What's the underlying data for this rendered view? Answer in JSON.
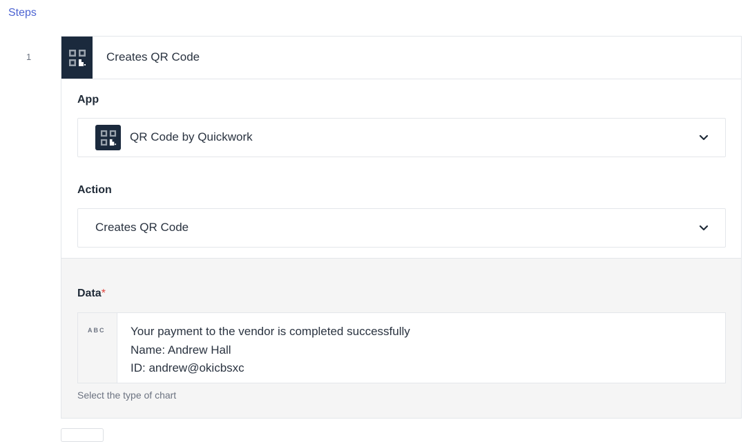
{
  "steps_title": "Steps",
  "step": {
    "number": "1",
    "header_title": "Creates QR Code",
    "app": {
      "label": "App",
      "value": "QR Code by Quickwork",
      "icon": "qr-code-icon"
    },
    "action": {
      "label": "Action",
      "value": "Creates QR Code"
    },
    "data_field": {
      "label": "Data",
      "required_mark": "*",
      "type_badge": "ABC",
      "lines": [
        "Your payment to the vendor is completed successfully",
        "Name: Andrew Hall",
        "ID: andrew@okicbsxc"
      ],
      "hint": "Select the type of chart"
    }
  },
  "colors": {
    "accent": "#4c63d2",
    "app_tile": "#1b2a3d",
    "required": "#e0443e",
    "section_bg": "#f5f5f5"
  }
}
